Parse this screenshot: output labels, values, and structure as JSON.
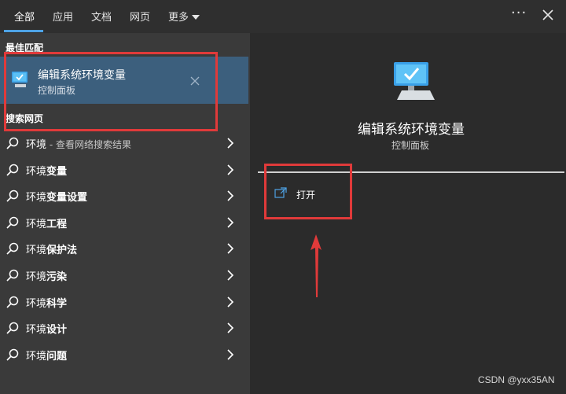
{
  "tabs": [
    {
      "label": "全部",
      "active": true
    },
    {
      "label": "应用"
    },
    {
      "label": "文档"
    },
    {
      "label": "网页"
    },
    {
      "label": "更多"
    }
  ],
  "left": {
    "best_match_label": "最佳匹配",
    "best_match": {
      "title": "编辑系统环境变量",
      "subtitle": "控制面板"
    },
    "web_label": "搜索网页",
    "results": [
      {
        "prefix": "环境",
        "bold": "",
        "hint": " - 查看网络搜索结果"
      },
      {
        "prefix": "环境",
        "bold": "变量",
        "hint": ""
      },
      {
        "prefix": "环境",
        "bold": "变量设置",
        "hint": ""
      },
      {
        "prefix": "环境",
        "bold": "工程",
        "hint": ""
      },
      {
        "prefix": "环境",
        "bold": "保护法",
        "hint": ""
      },
      {
        "prefix": "环境",
        "bold": "污染",
        "hint": ""
      },
      {
        "prefix": "环境",
        "bold": "科学",
        "hint": ""
      },
      {
        "prefix": "环境",
        "bold": "设计",
        "hint": ""
      },
      {
        "prefix": "环境",
        "bold": "问题",
        "hint": ""
      }
    ]
  },
  "right": {
    "title": "编辑系统环境变量",
    "subtitle": "控制面板",
    "open_label": "打开"
  },
  "watermark": "CSDN @yxx35AN",
  "colors": {
    "accent": "#4ea3e6",
    "annotation": "#e03a3a",
    "selected": "#3c5f7d"
  }
}
